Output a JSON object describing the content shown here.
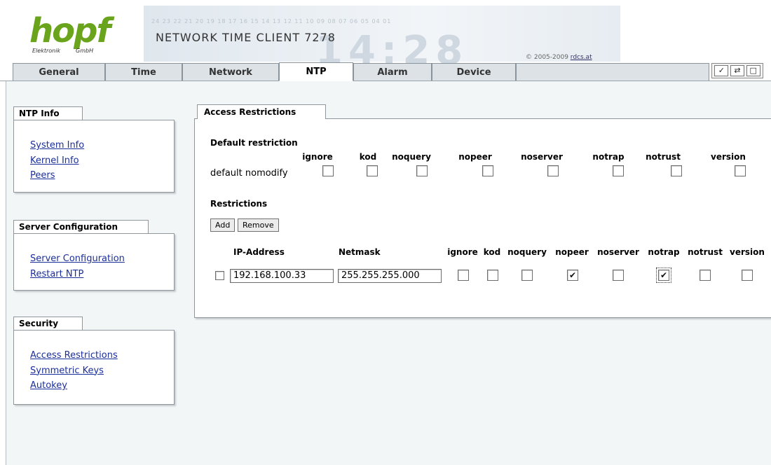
{
  "header": {
    "logo_text": "hopf",
    "logo_sub_left": "Elektronik",
    "logo_sub_right": "GmbH",
    "product_title": "NETWORK TIME CLIENT 7278",
    "background_digits": "24 23 22 21 20 19 18 17 16 15 14 13 12 11 10 09 08 07 06 05 04 01",
    "background_clock": "14:28",
    "copyright_text": "© 2005-2009",
    "copyright_link": "rdcs.at"
  },
  "tabs": [
    {
      "label": "General"
    },
    {
      "label": "Time"
    },
    {
      "label": "Network"
    },
    {
      "label": "NTP"
    },
    {
      "label": "Alarm"
    },
    {
      "label": "Device"
    }
  ],
  "active_tab": "NTP",
  "toolbar": {
    "apply_icon": "checkmark-icon",
    "reload_icon": "reload-icon",
    "save_icon": "save-icon",
    "apply_glyph": "✓",
    "reload_glyph": "⇄",
    "save_glyph": "□"
  },
  "sidebar": {
    "ntp_info": {
      "title": "NTP Info",
      "links": [
        "System Info",
        "Kernel Info",
        "Peers"
      ]
    },
    "server_configuration": {
      "title": "Server Configuration",
      "links": [
        "Server Configuration",
        "Restart NTP"
      ]
    },
    "security": {
      "title": "Security",
      "links": [
        "Access Restrictions",
        "Symmetric Keys",
        "Autokey"
      ]
    }
  },
  "access_restrictions": {
    "panel_title": "Access Restrictions",
    "default_restriction": {
      "label": "Default restriction",
      "row_label": "default nomodify",
      "flags": [
        {
          "name": "ignore",
          "checked": false
        },
        {
          "name": "kod",
          "checked": false
        },
        {
          "name": "noquery",
          "checked": false
        },
        {
          "name": "nopeer",
          "checked": false
        },
        {
          "name": "noserver",
          "checked": false
        },
        {
          "name": "notrap",
          "checked": false
        },
        {
          "name": "notrust",
          "checked": false
        },
        {
          "name": "version",
          "checked": false
        }
      ]
    },
    "restrictions": {
      "label": "Restrictions",
      "add_button": "Add",
      "remove_button": "Remove",
      "columns": {
        "ip": "IP-Address",
        "netmask": "Netmask",
        "flags": [
          "ignore",
          "kod",
          "noquery",
          "nopeer",
          "noserver",
          "notrap",
          "notrust",
          "version"
        ]
      },
      "rows": [
        {
          "selected": false,
          "ip": "192.168.100.33",
          "netmask": "255.255.255.000",
          "flags": [
            false,
            false,
            false,
            true,
            false,
            true,
            false,
            false
          ]
        }
      ]
    }
  },
  "colors": {
    "logo_green": "#6aa31c",
    "link_blue": "#1b2f9a",
    "content_bg": "#f2f6f7"
  }
}
